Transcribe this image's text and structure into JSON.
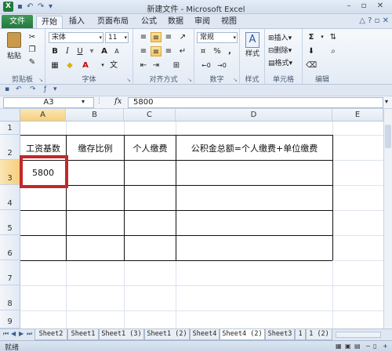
{
  "window": {
    "title": "新建文件 - Microsoft Excel",
    "logo": "X"
  },
  "ribbon_tabs": {
    "file": "文件",
    "tabs": [
      "开始",
      "插入",
      "页面布局",
      "公式",
      "数据",
      "审阅",
      "视图"
    ]
  },
  "clipboard": {
    "paste": "粘贴",
    "label": "剪贴板"
  },
  "font": {
    "name": "宋体",
    "size": "11",
    "bold": "B",
    "italic": "I",
    "underline": "U",
    "grow": "A",
    "shrink": "A",
    "label": "字体",
    "wen": "文"
  },
  "alignment": {
    "label": "对齐方式"
  },
  "number": {
    "format": "常规",
    "percent": "%",
    "comma": ",",
    "label": "数字"
  },
  "styles": {
    "label": "样式",
    "button": "样式"
  },
  "cells": {
    "insert": "插入",
    "delete": "删除",
    "format": "格式",
    "label": "单元格"
  },
  "editing": {
    "label": "编辑",
    "sum": "Σ"
  },
  "formula_bar": {
    "name_box": "A3",
    "fx": "fx",
    "value": "5800"
  },
  "columns": [
    "A",
    "B",
    "C",
    "D",
    "E"
  ],
  "rows": [
    "1",
    "2",
    "3",
    "4",
    "5",
    "6",
    "7",
    "8",
    "9"
  ],
  "table": {
    "headers": [
      "工资基数",
      "缴存比例",
      "个人缴费",
      "公积金总额=个人缴费+单位缴费"
    ],
    "a3": "5800"
  },
  "sheets": [
    "Sheet2",
    "Sheet1",
    "Sheet1 (3)",
    "Sheet1 (2)",
    "Sheet4",
    "Sheet4 (2)",
    "Sheet3",
    "1",
    "1 (2)"
  ],
  "status": {
    "ready": "就绪"
  }
}
